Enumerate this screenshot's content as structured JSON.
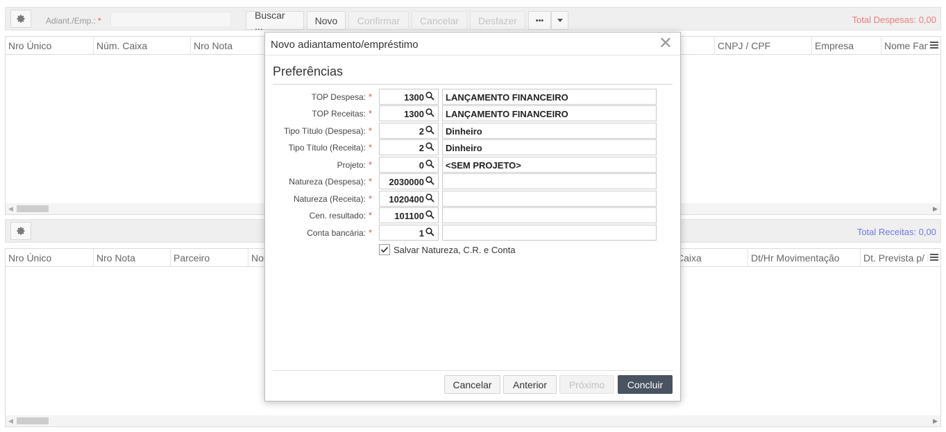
{
  "top_toolbar": {
    "adiant_label": "Adiant./Emp.:",
    "required_mark": "*",
    "buttons": {
      "buscar": "Buscar ...",
      "novo": "Novo",
      "confirmar": "Confirmar",
      "cancelar": "Cancelar",
      "desfazer": "Desfazer",
      "more": "•••"
    },
    "total_label": "Total Despesas: 0,00"
  },
  "grid_top": {
    "columns": [
      "Nro Único",
      "Núm. Caixa",
      "Nro Nota",
      "CNPJ / CPF",
      "Empresa",
      "Nome Fan"
    ]
  },
  "mid_toolbar": {
    "total_label": "Total Receitas: 0,00"
  },
  "grid_bottom": {
    "columns": [
      "Nro Único",
      "Nro Nota",
      "Parceiro",
      "Nor",
      "Caixa",
      "Dt/Hr Movimentação",
      "Dt. Prevista p/ E"
    ]
  },
  "dialog": {
    "title": "Novo adiantamento/empréstimo",
    "close_glyph": "✕",
    "section_title": "Preferências",
    "required_mark": "*",
    "fields": [
      {
        "label": "TOP Despesa:",
        "code": "1300",
        "desc": "LANÇAMENTO FINANCEIRO"
      },
      {
        "label": "TOP Receitas:",
        "code": "1300",
        "desc": "LANÇAMENTO FINANCEIRO"
      },
      {
        "label": "Tipo Título (Despesa):",
        "code": "2",
        "desc": "Dinheiro"
      },
      {
        "label": "Tipo Título (Receita):",
        "code": "2",
        "desc": "Dinheiro"
      },
      {
        "label": "Projeto:",
        "code": "0",
        "desc": "<SEM PROJETO>"
      },
      {
        "label": "Natureza (Despesa):",
        "code": "2030000",
        "desc": ""
      },
      {
        "label": "Natureza (Receita):",
        "code": "1020400",
        "desc": ""
      },
      {
        "label": "Cen. resultado:",
        "code": "101100",
        "desc": ""
      },
      {
        "label": "Conta bancária:",
        "code": "1",
        "desc": ""
      }
    ],
    "checkbox": {
      "label": "Salvar Natureza, C.R. e Conta",
      "checked": true
    },
    "buttons": {
      "cancelar": "Cancelar",
      "anterior": "Anterior",
      "proximo": "Próximo",
      "concluir": "Concluir"
    }
  },
  "colors": {
    "total_despesas": "#f07b7b",
    "total_receitas": "#6f77e0",
    "primary_button": "#4a5361",
    "required": "#e05353"
  }
}
